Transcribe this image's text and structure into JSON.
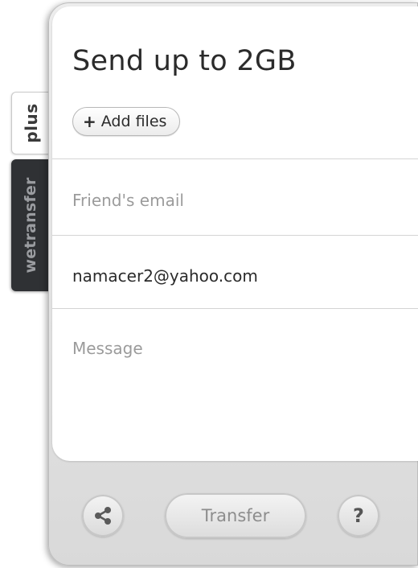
{
  "tabs": {
    "plus_label": "plus",
    "wetransfer_label": "wetransfer"
  },
  "form": {
    "title": "Send up to 2GB",
    "add_files_label": "Add files",
    "add_files_icon": "plus-icon",
    "friend_email_placeholder": "Friend's email",
    "your_email_value": "namacer2@yahoo.com",
    "message_placeholder": "Message"
  },
  "actions": {
    "share_icon": "share-icon",
    "transfer_label": "Transfer",
    "help_label": "?"
  },
  "colors": {
    "wetransfer_tab": "#2f3134",
    "panel_bg": "#ffffff",
    "placeholder_text": "#9b9b9b",
    "transfer_text": "#8d8d8d"
  }
}
